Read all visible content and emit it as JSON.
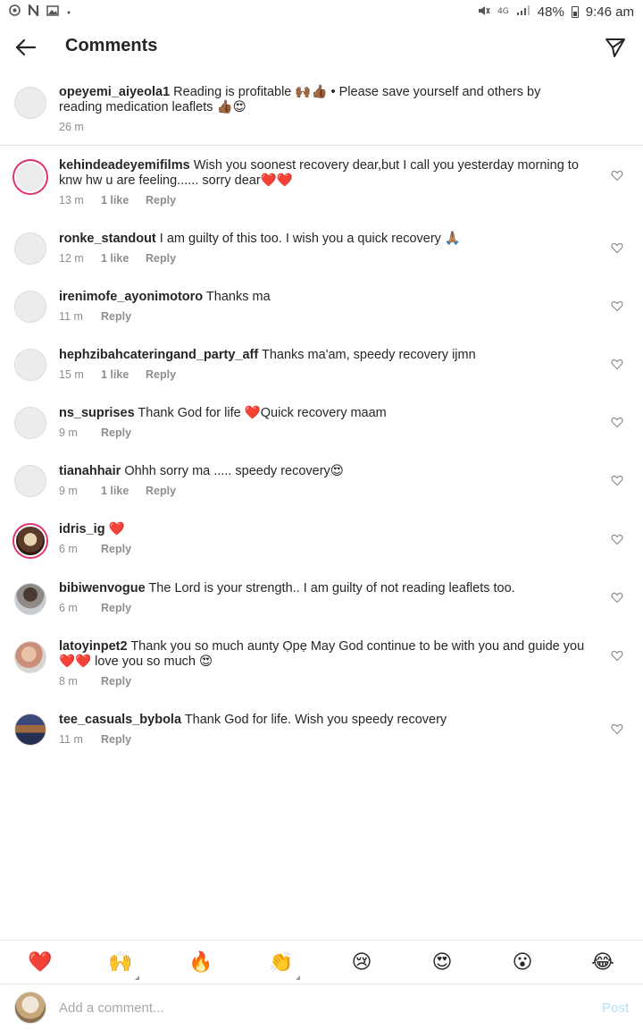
{
  "status_bar": {
    "left_icons": [
      "chrome-icon",
      "n-icon",
      "image-icon",
      "dot-icon"
    ],
    "battery": "48%",
    "network": "4G",
    "time": "9:46 am"
  },
  "header": {
    "title": "Comments"
  },
  "caption": {
    "username": "opeyemi_aiyeola1",
    "text": "Reading is profitable 🙌🏾👍🏾 • Please save yourself and others by reading medication leaflets 👍🏾😍",
    "time": "26 m"
  },
  "comments": [
    {
      "username": "kehindeadeyemifilms",
      "text": "Wish you soonest recovery dear,but I call you yesterday morning to knw hw u are feeling...... sorry dear❤️❤️",
      "time": "13 m",
      "likes": "1 like",
      "reply": "Reply"
    },
    {
      "username": "ronke_standout",
      "text": "I am guilty of this too. I wish you a quick recovery 🙏🏽",
      "time": "12 m",
      "likes": "1 like",
      "reply": "Reply"
    },
    {
      "username": "irenimofe_ayonimotoro",
      "text": "Thanks ma",
      "time": "11 m",
      "likes": "",
      "reply": "Reply"
    },
    {
      "username": "hephzibahcateringand_party_aff",
      "text": "Thanks ma'am, speedy recovery ijmn",
      "time": "15 m",
      "likes": "1 like",
      "reply": "Reply"
    },
    {
      "username": "ns_suprises",
      "text": "Thank God for life ❤️Quick recovery maam",
      "time": "9 m",
      "likes": "",
      "reply": "Reply"
    },
    {
      "username": "tianahhair",
      "text": "Ohhh sorry ma ..... speedy recovery😍",
      "time": "9 m",
      "likes": "1 like",
      "reply": "Reply"
    },
    {
      "username": "idris_ig",
      "text": "❤️",
      "time": "6 m",
      "likes": "",
      "reply": "Reply"
    },
    {
      "username": "bibiwenvogue",
      "text": "The Lord is your strength.. I am guilty of not reading leaflets too.",
      "time": "6 m",
      "likes": "",
      "reply": "Reply"
    },
    {
      "username": "latoyinpet2",
      "text": "Thank you so much aunty Ọpẹ May God continue to be with you and guide you ❤️❤️ love you so much 😍",
      "time": "8 m",
      "likes": "",
      "reply": "Reply"
    },
    {
      "username": "tee_casuals_bybola",
      "text": "Thank God for life. Wish you speedy recovery",
      "time": "11 m",
      "likes": "",
      "reply": "Reply"
    }
  ],
  "emoji_bar": [
    "❤️",
    "🙌",
    "🔥",
    "👏",
    "😢",
    "😍",
    "😮",
    "😂"
  ],
  "composer": {
    "placeholder": "Add a comment...",
    "post_label": "Post"
  }
}
